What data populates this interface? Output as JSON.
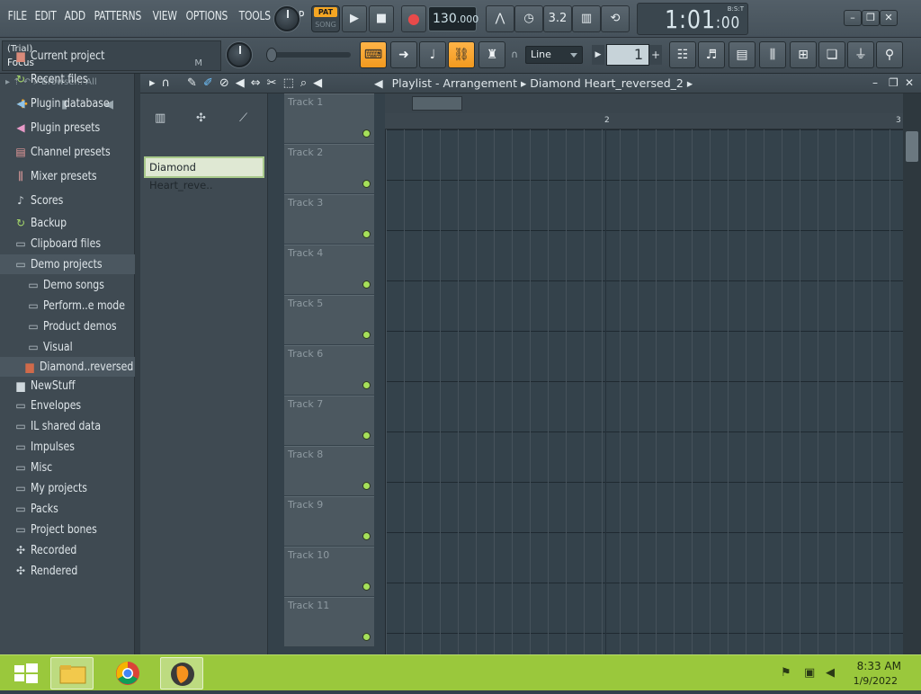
{
  "menu": [
    "FILE",
    "EDIT",
    "ADD",
    "PATTERNS",
    "VIEW",
    "OPTIONS",
    "TOOLS",
    "HELP"
  ],
  "transport": {
    "pat_label": "PAT",
    "song_label": "SONG",
    "tempo_int": "130",
    "tempo_dec": ".000"
  },
  "clock": {
    "time": "1:01",
    "sub": ":00",
    "label": "B:S:T"
  },
  "hint": {
    "line1": "(Trial)",
    "line2": "Focus",
    "mode": "M"
  },
  "snap": {
    "value": "Line"
  },
  "pattern": {
    "value": "1"
  },
  "browser": {
    "header": "Browser.. All",
    "items": [
      {
        "label": "Current project",
        "icon": "current-project-icon",
        "type": "root"
      },
      {
        "label": "Recent files",
        "icon": "recent-files-icon",
        "type": "root"
      },
      {
        "label": "Plugin database",
        "icon": "plugin-database-icon",
        "type": "root"
      },
      {
        "label": "Plugin presets",
        "icon": "plugin-presets-icon",
        "type": "root"
      },
      {
        "label": "Channel presets",
        "icon": "channel-presets-icon",
        "type": "root"
      },
      {
        "label": "Mixer presets",
        "icon": "mixer-presets-icon",
        "type": "root"
      },
      {
        "label": "Scores",
        "icon": "scores-icon",
        "type": "root"
      },
      {
        "label": "Backup",
        "icon": "backup-icon",
        "type": "root"
      },
      {
        "label": "Clipboard files",
        "icon": "clipboard-files-icon",
        "type": "root"
      },
      {
        "label": "Demo projects",
        "icon": "folder-open-icon",
        "type": "root",
        "selected": true
      },
      {
        "label": "Demo songs",
        "icon": "folder-icon",
        "type": "child"
      },
      {
        "label": "Perform..e mode",
        "icon": "folder-icon",
        "type": "child"
      },
      {
        "label": "Product demos",
        "icon": "folder-icon",
        "type": "child"
      },
      {
        "label": "Visual",
        "icon": "folder-icon",
        "type": "child"
      },
      {
        "label": "Diamond..reversed",
        "icon": "audio-file-icon",
        "type": "file",
        "selected": true
      },
      {
        "label": "NewStuff",
        "icon": "new-stuff-icon",
        "type": "root"
      },
      {
        "label": "Envelopes",
        "icon": "folder-icon",
        "type": "root"
      },
      {
        "label": "IL shared data",
        "icon": "folder-icon",
        "type": "root"
      },
      {
        "label": "Impulses",
        "icon": "folder-icon",
        "type": "root"
      },
      {
        "label": "Misc",
        "icon": "folder-icon",
        "type": "root"
      },
      {
        "label": "My projects",
        "icon": "folder-icon",
        "type": "root"
      },
      {
        "label": "Packs",
        "icon": "folder-icon",
        "type": "root"
      },
      {
        "label": "Project bones",
        "icon": "folder-icon",
        "type": "root"
      },
      {
        "label": "Recorded",
        "icon": "recorded-icon",
        "type": "root"
      },
      {
        "label": "Rendered",
        "icon": "rendered-icon",
        "type": "root"
      }
    ]
  },
  "playlist": {
    "title": "Playlist - Arrangement",
    "pattern_name": "Diamond Heart_reversed_2",
    "clip_name": "Diamond Heart_reve..",
    "ruler": [
      "2",
      "3"
    ],
    "tracks": [
      "Track 1",
      "Track 2",
      "Track 3",
      "Track 4",
      "Track 5",
      "Track 6",
      "Track 7",
      "Track 8",
      "Track 9",
      "Track 10",
      "Track 11"
    ]
  },
  "taskbar": {
    "time": "8:33 AM",
    "date": "1/9/2022"
  },
  "colors": {
    "accent_orange": "#f5a623",
    "led_green": "#a6e05a",
    "taskbar_green": "#9ac83c"
  }
}
